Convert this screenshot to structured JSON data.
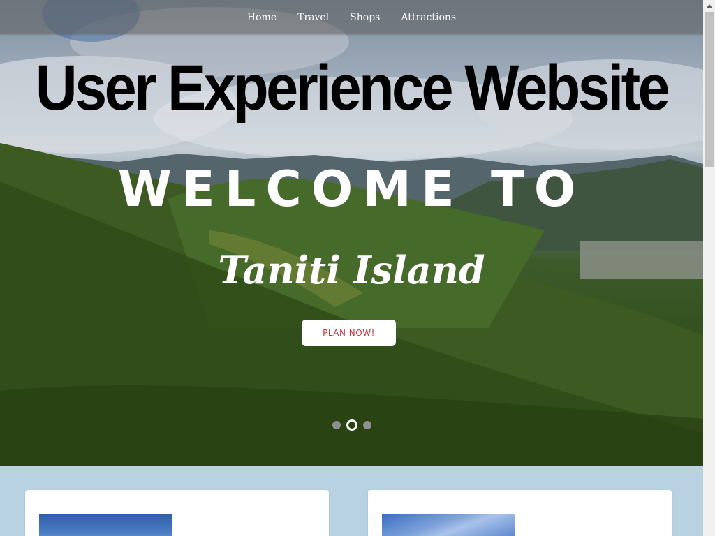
{
  "nav": {
    "items": [
      {
        "label": "Home"
      },
      {
        "label": "Travel"
      },
      {
        "label": "Shops"
      },
      {
        "label": "Attractions"
      }
    ]
  },
  "hero": {
    "site_title": "User Experience Website",
    "welcome": "WELCOME TO",
    "island_name": "Taniti Island",
    "cta_label": "PLAN NOW!",
    "carousel": {
      "total": 3,
      "active_index": 2
    },
    "colors": {
      "title": "#000000",
      "welcome": "#ffffff",
      "cta_text": "#d0303a",
      "nav_bar": "#5f5f5f"
    }
  },
  "lower_section": {
    "background": "#b9d2e1",
    "cards": [
      {
        "name": "card-1"
      },
      {
        "name": "card-2"
      }
    ]
  }
}
